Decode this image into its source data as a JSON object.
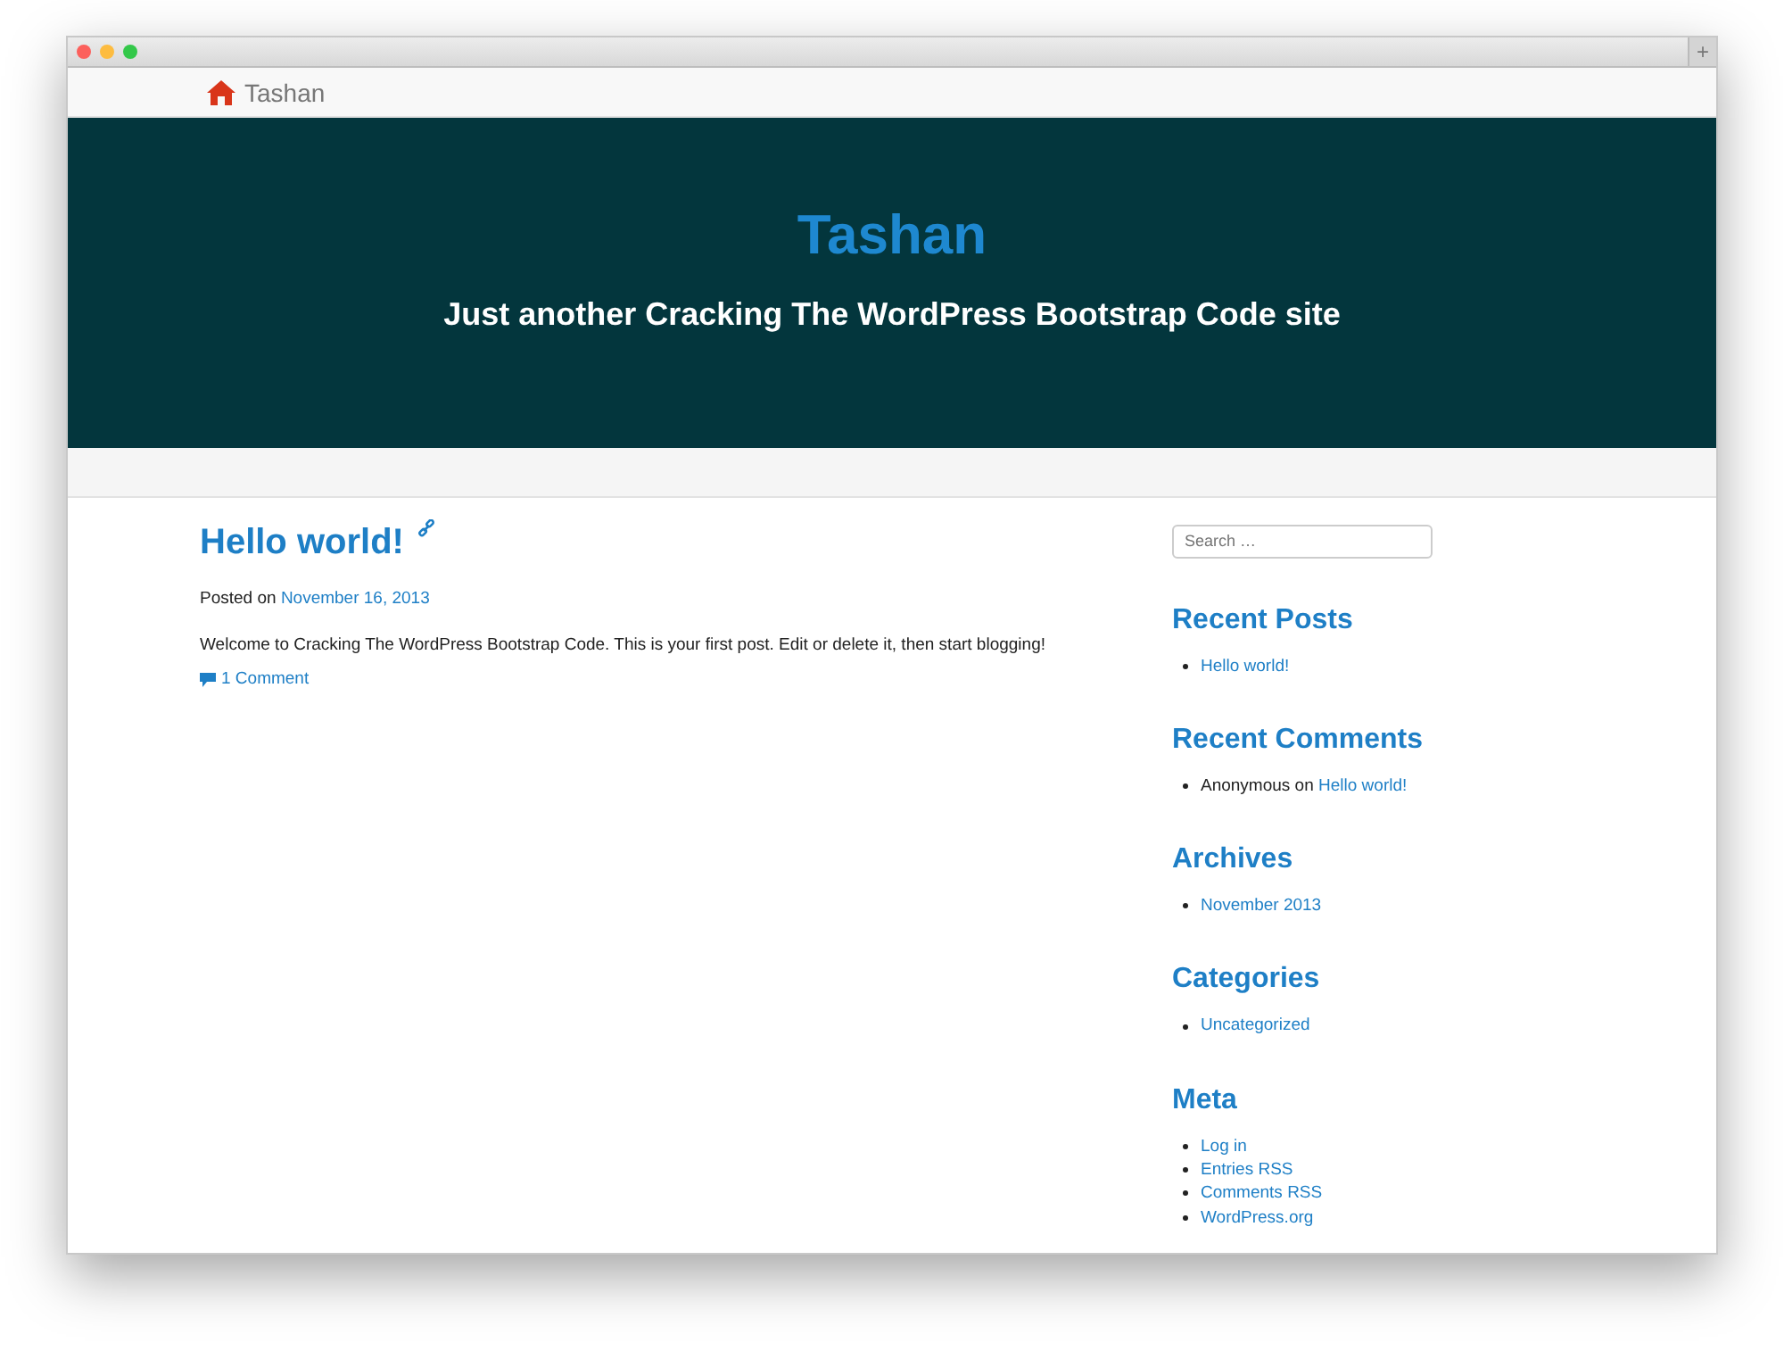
{
  "browser": {
    "new_tab_button": "+"
  },
  "navbar": {
    "brand": "Tashan"
  },
  "header": {
    "title": "Tashan",
    "tagline": "Just another Cracking The WordPress Bootstrap Code site"
  },
  "post": {
    "title": "Hello world!",
    "posted_prefix": "Posted on",
    "date": "November 16, 2013",
    "body": "Welcome to Cracking The WordPress Bootstrap Code. This is your first post. Edit or delete it, then start blogging!",
    "comments": "1 Comment"
  },
  "sidebar": {
    "search": {
      "placeholder": "Search …"
    },
    "widgets": [
      {
        "title": "Recent Posts",
        "items": [
          {
            "link": "Hello world!"
          }
        ]
      },
      {
        "title": "Recent Comments",
        "items": [
          {
            "prefix": "Anonymous on",
            "link": "Hello world!"
          }
        ]
      },
      {
        "title": "Archives",
        "items": [
          {
            "link": "November 2013"
          }
        ]
      },
      {
        "title": "Categories",
        "items": [
          {
            "link": "Uncategorized"
          }
        ]
      },
      {
        "title": "Meta",
        "items": [
          {
            "link": "Log in"
          },
          {
            "link": "Entries RSS"
          },
          {
            "link": "Comments RSS"
          },
          {
            "link": "WordPress.org"
          }
        ]
      }
    ]
  }
}
